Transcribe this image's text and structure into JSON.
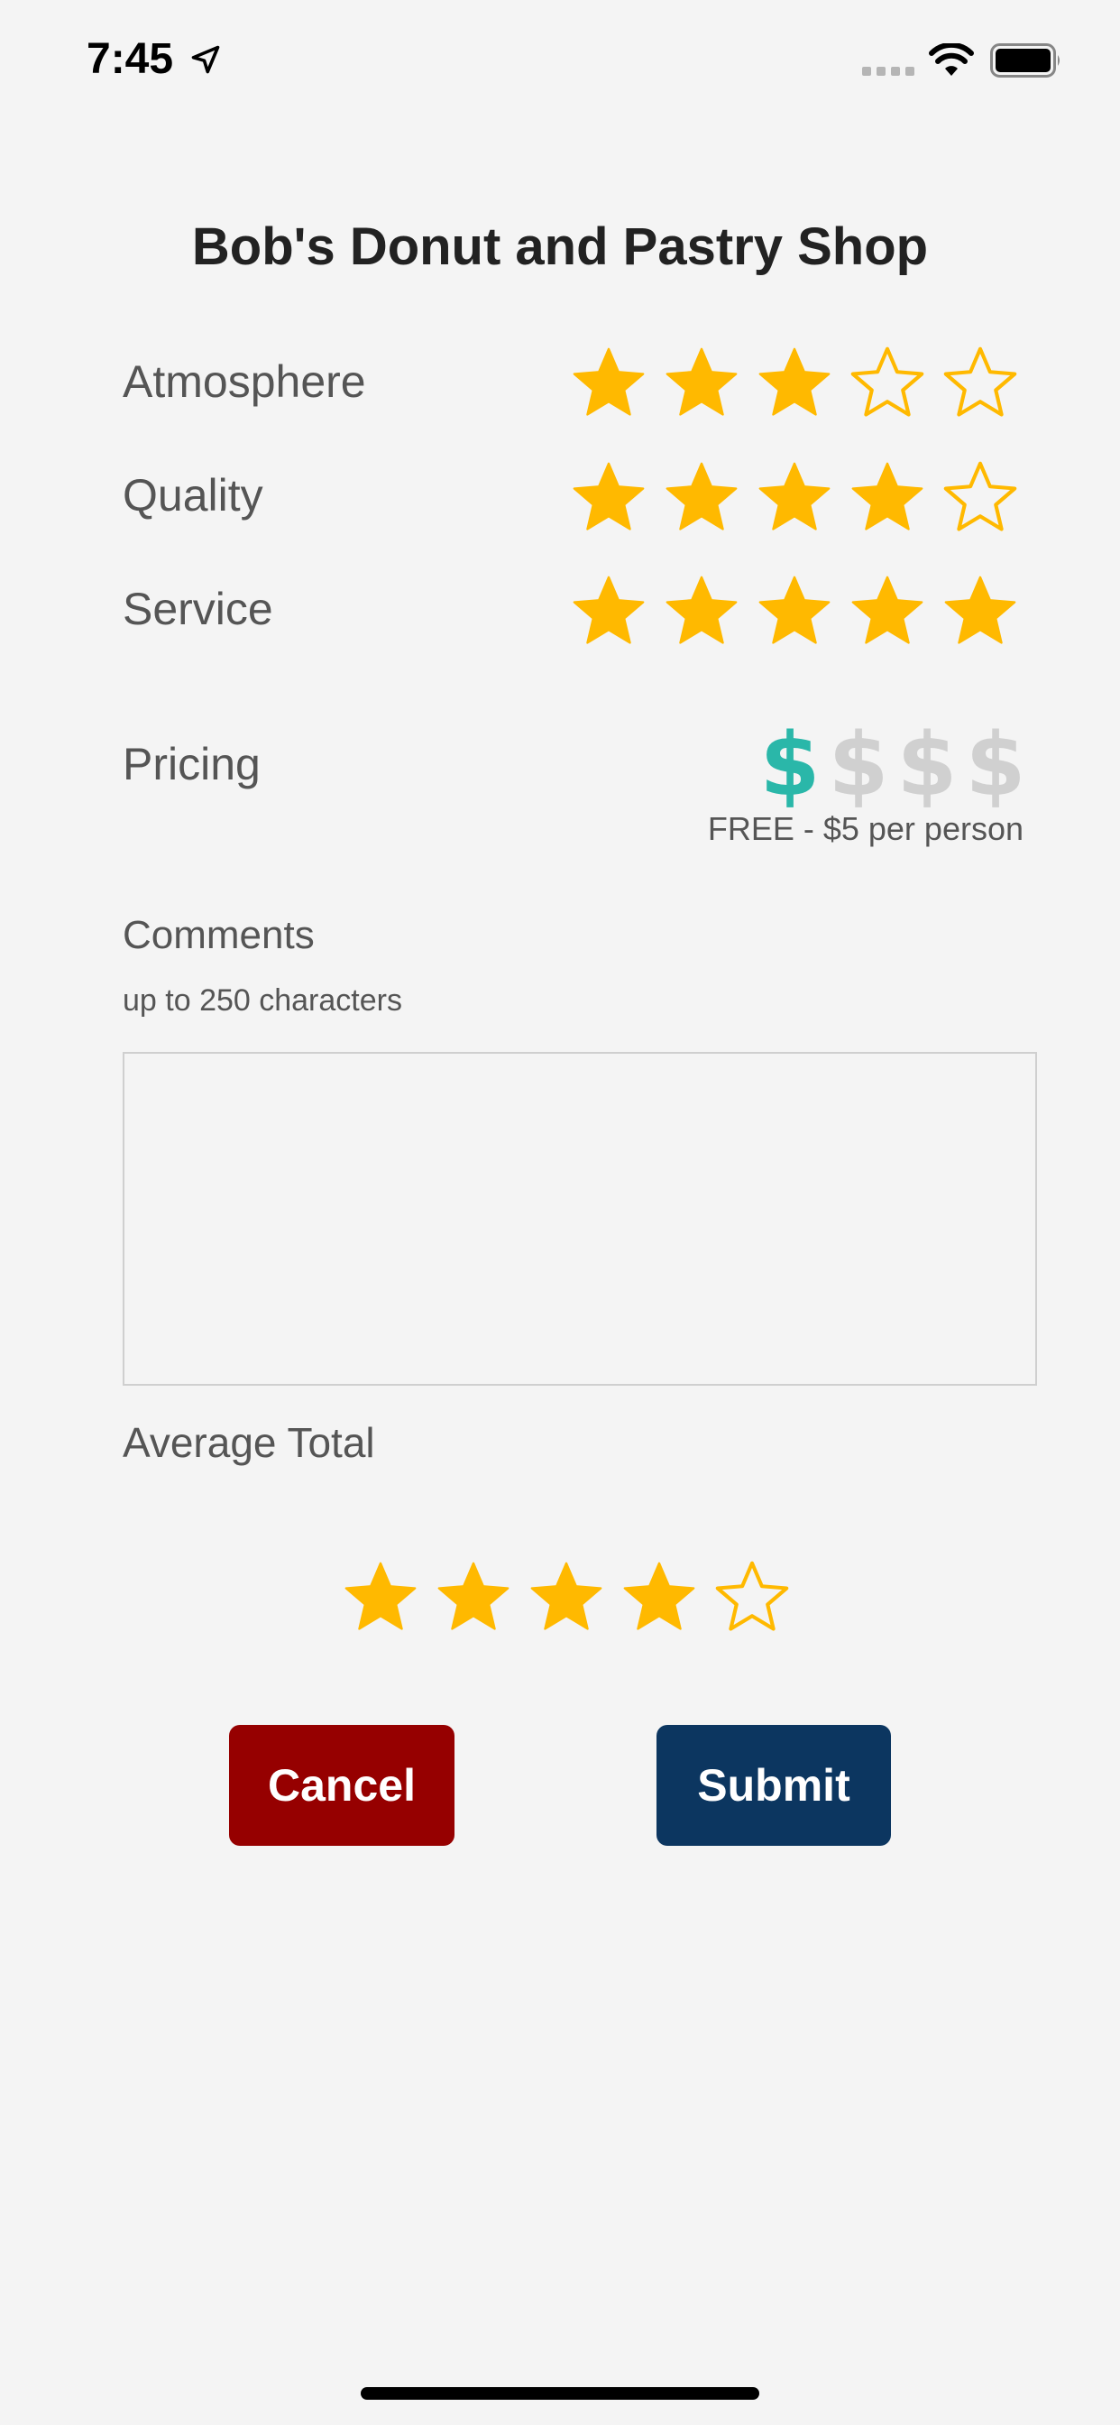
{
  "status_bar": {
    "time": "7:45"
  },
  "title": "Bob's Donut and Pastry Shop",
  "colors": {
    "star": "#FFB900",
    "dollar_active": "#2AB7A9",
    "dollar_inactive": "#D0D0D0",
    "cancel": "#960000",
    "submit": "#0C3660"
  },
  "ratings": [
    {
      "label": "Atmosphere",
      "value": 3,
      "max": 5
    },
    {
      "label": "Quality",
      "value": 4,
      "max": 5
    },
    {
      "label": "Service",
      "value": 5,
      "max": 5
    }
  ],
  "pricing": {
    "label": "Pricing",
    "symbol": "$",
    "value": 1,
    "max": 4,
    "note": "FREE - $5 per person"
  },
  "comments": {
    "label": "Comments",
    "hint": "up to 250 characters",
    "value": ""
  },
  "average": {
    "label": "Average Total",
    "value": 4,
    "max": 5
  },
  "buttons": {
    "cancel": "Cancel",
    "submit": "Submit"
  }
}
